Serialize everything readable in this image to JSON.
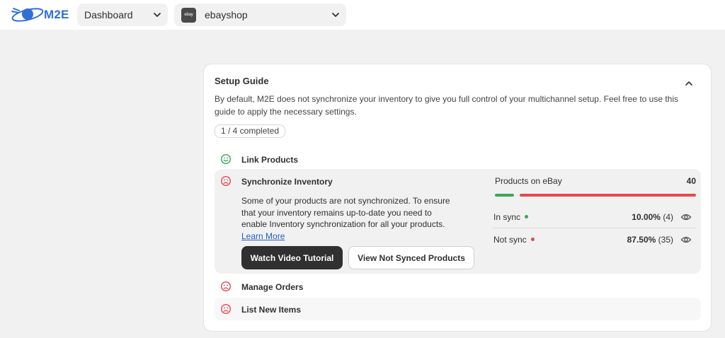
{
  "header": {
    "brand": "M2E",
    "dashboard_select": "Dashboard",
    "account_badge": "ebay",
    "account_select": "ebayshop"
  },
  "setup_guide": {
    "title": "Setup Guide",
    "description": "By default, M2E does not synchronize your inventory to give you full control of your multichannel setup. Feel free to use this guide to apply the necessary settings.",
    "progress": "1 / 4 completed",
    "steps": [
      {
        "label": "Link Products",
        "status": "complete"
      },
      {
        "label": "Synchronize Inventory",
        "status": "incomplete",
        "text": "Some of your products are not synchronized. To ensure that your inventory remains up-to-date you need to enable Inventory synchronization for all your products.",
        "link": "Learn More",
        "primary_button": "Watch Video Tutorial",
        "secondary_button": "View Not Synced Products",
        "stats": {
          "title": "Products on eBay",
          "total": "40",
          "in_sync_label": "In sync",
          "in_sync_percent": "10.00%",
          "in_sync_count": "(4)",
          "not_sync_label": "Not sync",
          "not_sync_percent": "87.50%",
          "not_sync_count": "(35)",
          "in_sync_fraction": 0.1,
          "not_sync_fraction": 0.875
        }
      },
      {
        "label": "Manage Orders",
        "status": "incomplete"
      },
      {
        "label": "List New Items",
        "status": "incomplete"
      }
    ]
  },
  "colors": {
    "success": "#3aa655",
    "critical": "#e5484d",
    "brand": "#2f6fd6"
  }
}
